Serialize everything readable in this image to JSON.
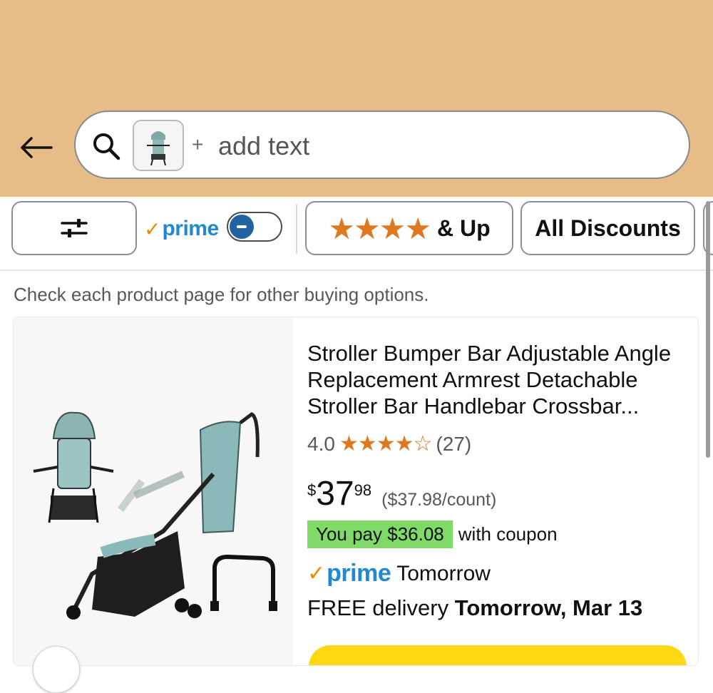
{
  "header": {
    "search_placeholder": "add text",
    "plus_symbol": "+",
    "back_icon": "arrow-left-icon",
    "search_icon": "search-icon"
  },
  "filters": {
    "filter_icon": "sliders-icon",
    "prime_check": "✓",
    "prime_label": "prime",
    "prime_toggle_on": false,
    "rating_stars": "★★★★",
    "rating_label": "& Up",
    "discounts_label": "All Discounts"
  },
  "note": "Check each product page for other buying options.",
  "product": {
    "title": "Stroller Bumper Bar Adjustable Angle Replacement Armrest Detachable Stroller Bar Handlebar Crossbar...",
    "rating_value": "4.0",
    "rating_stars": "★★★★☆",
    "rating_count": "(27)",
    "price_symbol": "$",
    "price_whole": "37",
    "price_fraction": "98",
    "unit_price": "($37.98/count)",
    "coupon_badge": "You pay $36.08",
    "coupon_text": "with coupon",
    "prime_check": "✓",
    "prime_label": "prime",
    "delivery_day": "Tomorrow",
    "delivery_prefix": "FREE delivery ",
    "delivery_date": "Tomorrow, Mar 13"
  },
  "colors": {
    "header_bg": "#e6bd88",
    "star": "#de7921",
    "prime_blue": "#1f8ad1",
    "coupon_green": "#7fda68",
    "cart_yellow": "#ffd814"
  }
}
